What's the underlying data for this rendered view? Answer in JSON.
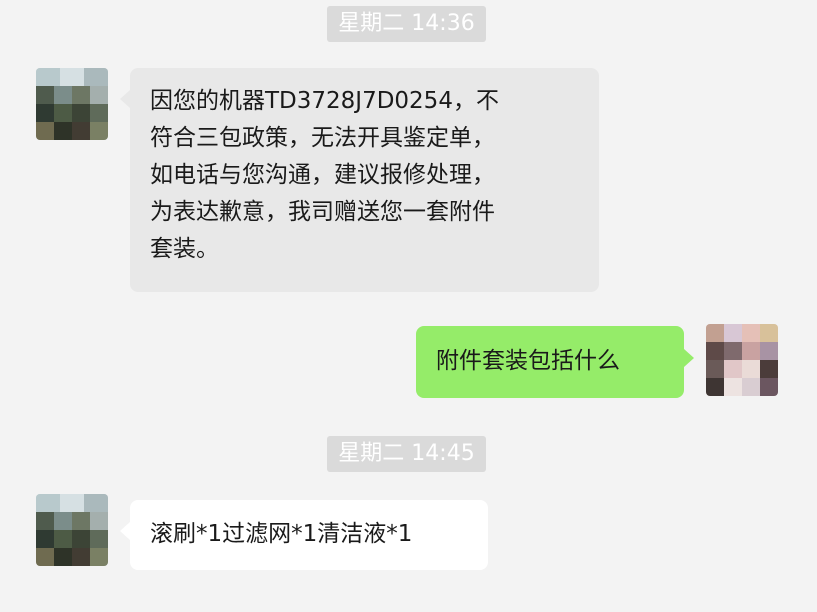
{
  "chat": {
    "timestamp_1": "星期二 14:36",
    "msg_1_lines": [
      "因您的机器TD3728J7D0254，不",
      "符合三包政策，无法开具鉴定单，",
      "如电话与您沟通，建议报修处理，",
      "为表达歉意，我司赠送您一套附件",
      "套装。"
    ],
    "msg_2": "附件套装包括什么",
    "timestamp_2": "星期二 14:45",
    "msg_3": "滚刷*1过滤网*1清洁液*1"
  },
  "colors": {
    "background": "#f3f3f3",
    "received_bubble_first": "#e8e8e8",
    "received_bubble_white": "#ffffff",
    "sent_bubble": "#95ec69",
    "timestamp_bg": "#dadada",
    "timestamp_text": "#ffffff"
  },
  "avatars": {
    "contact": "contact-avatar-icon",
    "self": "self-avatar-icon"
  }
}
